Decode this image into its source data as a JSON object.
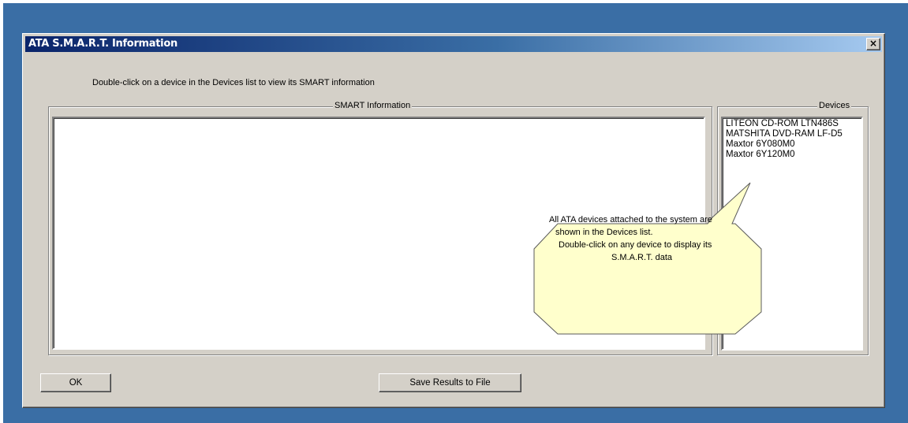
{
  "window": {
    "title": "ATA S.M.A.R.T. Information",
    "close_glyph": "×"
  },
  "instruction": "Double-click on a device in the Devices list to view its SMART information",
  "smart_panel": {
    "label": "SMART Information"
  },
  "devices_panel": {
    "label": "Devices",
    "items": [
      "LITEON CD-ROM LTN486S",
      "MATSHITA DVD-RAM LF-D5",
      "Maxtor 6Y080M0",
      "Maxtor 6Y120M0"
    ]
  },
  "callout": {
    "lines": [
      "All ATA devices attached to the system are",
      "shown in the Devices list.",
      "Double-click on any device to display its",
      "S.M.A.R.T. data"
    ]
  },
  "buttons": {
    "ok": "OK",
    "save": "Save Results to File"
  },
  "colors": {
    "desktop": "#3a6ea5",
    "window_face": "#d4d0c8",
    "title_start": "#0a246a",
    "callout_fill": "#ffffcc"
  }
}
